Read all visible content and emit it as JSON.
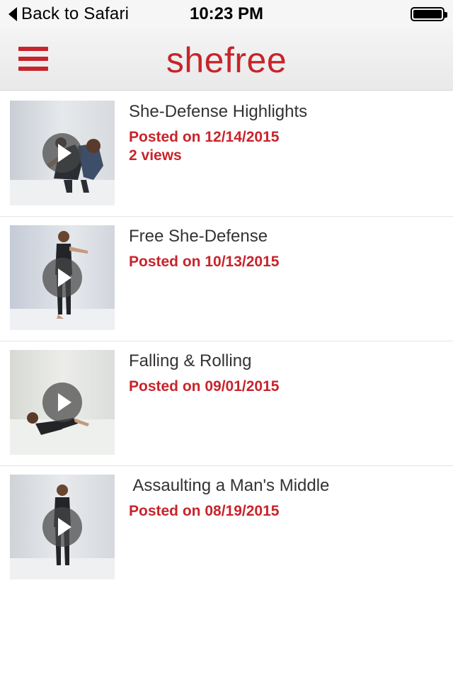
{
  "status_bar": {
    "back_label": "Back to Safari",
    "time": "10:23 PM",
    "battery_level": 1.0
  },
  "header": {
    "brand": "shefree",
    "menu_icon": "hamburger-icon",
    "accent_color": "#c8242b"
  },
  "videos": [
    {
      "title": "She-Defense Highlights",
      "posted": "Posted on 12/14/2015",
      "views": "2 views",
      "thumb_icon": "play-icon"
    },
    {
      "title": "Free She-Defense",
      "posted": "Posted on 10/13/2015",
      "views": "",
      "thumb_icon": "play-icon"
    },
    {
      "title": "Falling & Rolling",
      "posted": "Posted on 09/01/2015",
      "views": "",
      "thumb_icon": "play-icon"
    },
    {
      "title": " Assaulting a Man's Middle",
      "posted": "Posted on 08/19/2015",
      "views": "",
      "thumb_icon": "play-icon"
    }
  ]
}
